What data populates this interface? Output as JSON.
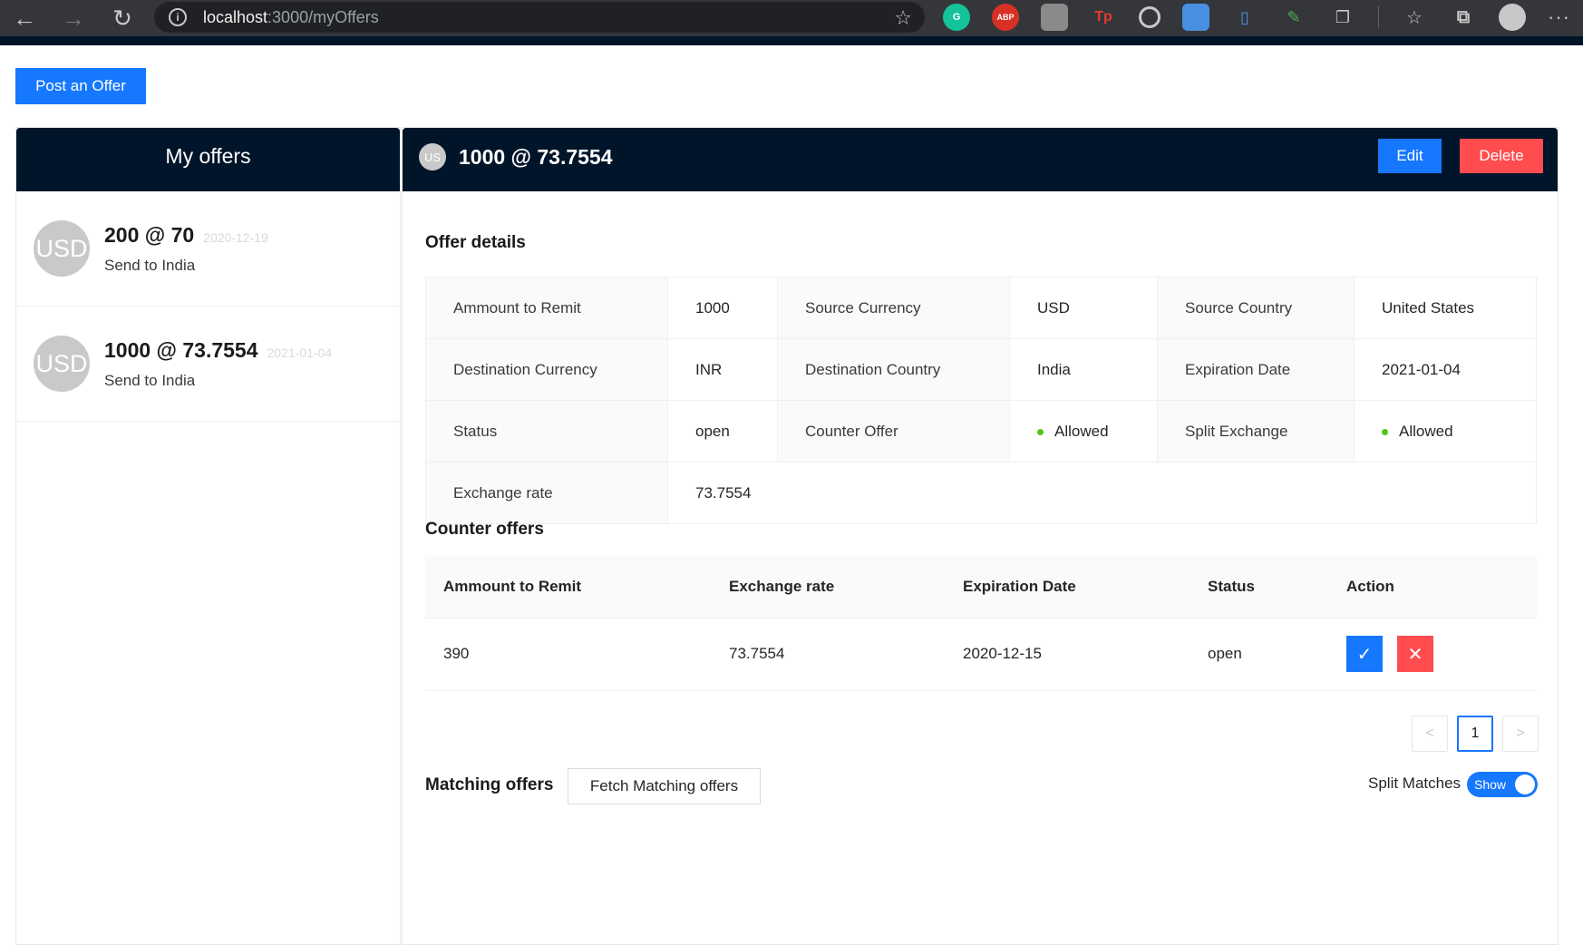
{
  "browser": {
    "url_host": "localhost",
    "url_path": ":3000/myOffers",
    "extensions": [
      "grammarly-icon",
      "adblock-icon",
      "reader-icon",
      "tp-icon",
      "target-icon",
      "screenshot-icon",
      "clip-icon",
      "pen-icon",
      "copy-icon"
    ]
  },
  "page": {
    "post_button": "Post an Offer"
  },
  "my_offers": {
    "title": "My offers",
    "items": [
      {
        "avatar": "USD",
        "title": "200 @ 70",
        "date": "2020-12-19",
        "subtitle": "Send to India"
      },
      {
        "avatar": "USD",
        "title": "1000 @ 73.7554",
        "date": "2021-01-04",
        "subtitle": "Send to India"
      }
    ]
  },
  "offer": {
    "avatar": "US",
    "title": "1000 @ 73.7554",
    "edit_label": "Edit",
    "delete_label": "Delete",
    "details_title": "Offer details",
    "details": {
      "amount_label": "Ammount to Remit",
      "amount": "1000",
      "source_currency_label": "Source Currency",
      "source_currency": "USD",
      "source_country_label": "Source Country",
      "source_country": "United States",
      "dest_currency_label": "Destination Currency",
      "dest_currency": "INR",
      "dest_country_label": "Destination Country",
      "dest_country": "India",
      "expiration_label": "Expiration Date",
      "expiration": "2021-01-04",
      "status_label": "Status",
      "status": "open",
      "counter_offer_label": "Counter Offer",
      "counter_offer": "Allowed",
      "split_exchange_label": "Split Exchange",
      "split_exchange": "Allowed",
      "exchange_rate_label": "Exchange rate",
      "exchange_rate": "73.7554"
    }
  },
  "counter_offers": {
    "title": "Counter offers",
    "columns": [
      "Ammount to Remit",
      "Exchange rate",
      "Expiration Date",
      "Status",
      "Action"
    ],
    "rows": [
      {
        "amount": "390",
        "rate": "73.7554",
        "expiration": "2020-12-15",
        "status": "open"
      }
    ],
    "pagination": {
      "prev": "<",
      "current": "1",
      "next": ">"
    }
  },
  "matching": {
    "title": "Matching offers",
    "fetch_button": "Fetch Matching offers",
    "split_label": "Split Matches",
    "toggle_text": "Show"
  },
  "colors": {
    "primary": "#1677ff",
    "danger": "#ff4d4f",
    "header_dark": "#001529",
    "success_dot": "#52c41a"
  }
}
